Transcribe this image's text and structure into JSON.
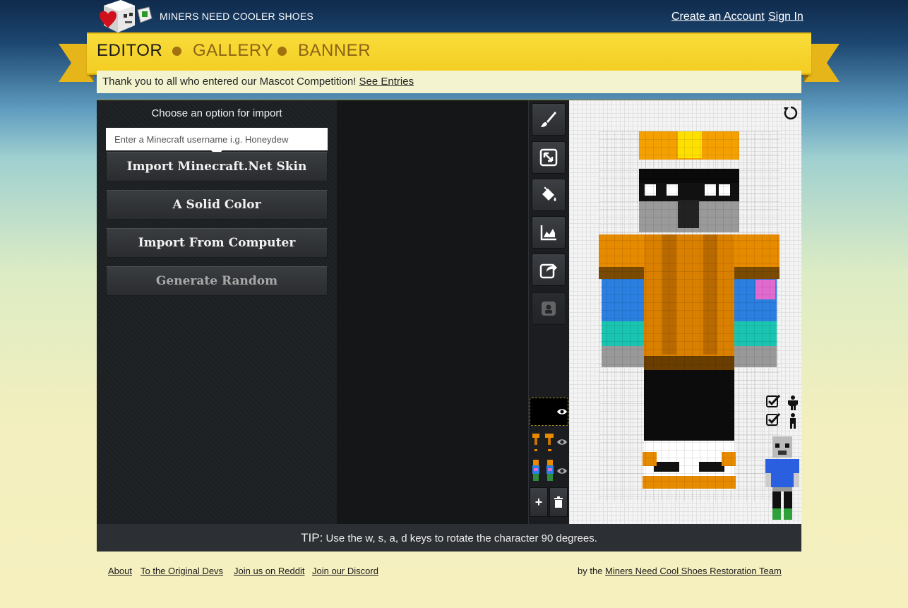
{
  "header": {
    "site_name": "MINERS NEED COOLER SHOES",
    "create_account": "Create an Account",
    "sign_in": "Sign In"
  },
  "nav": {
    "editor": "EDITOR",
    "gallery": "GALLERY",
    "banner": "BANNER"
  },
  "notice": {
    "text": "Thank you to all who entered our Mascot Competition! ",
    "link": "See Entries"
  },
  "import_panel": {
    "title": "Choose an option for import",
    "username_placeholder": "Enter a Minecraft username i.g. Honeydew",
    "username_value": "",
    "buttons": [
      "Import Minecraft.Net Skin",
      "A Solid Color",
      "Import From Computer",
      "Generate Random"
    ]
  },
  "toolbar": {
    "tools": [
      "brush-icon",
      "resize-icon",
      "paint-bucket-icon",
      "chart-icon",
      "share-icon",
      "portrait-icon"
    ]
  },
  "layers": {
    "add_label": "+",
    "delete_icon": "trash-icon"
  },
  "tip": {
    "label": "TIP:",
    "text": " Use the w, s, a, d keys to rotate the character 90 degrees."
  },
  "footer": {
    "links": [
      "About",
      "To the Original Devs",
      "Join us on Reddit",
      "Join our Discord"
    ],
    "credit_prefix": "by the ",
    "credit_link": "Miners Need Cool Shoes Restoration Team"
  },
  "colors": {
    "ribbon": "#f3cd22",
    "nav_active": "#1b1b1b",
    "nav_inactive": "#8b6414",
    "skin_orange": "#e68a00",
    "skin_blue": "#2a7fe0"
  }
}
